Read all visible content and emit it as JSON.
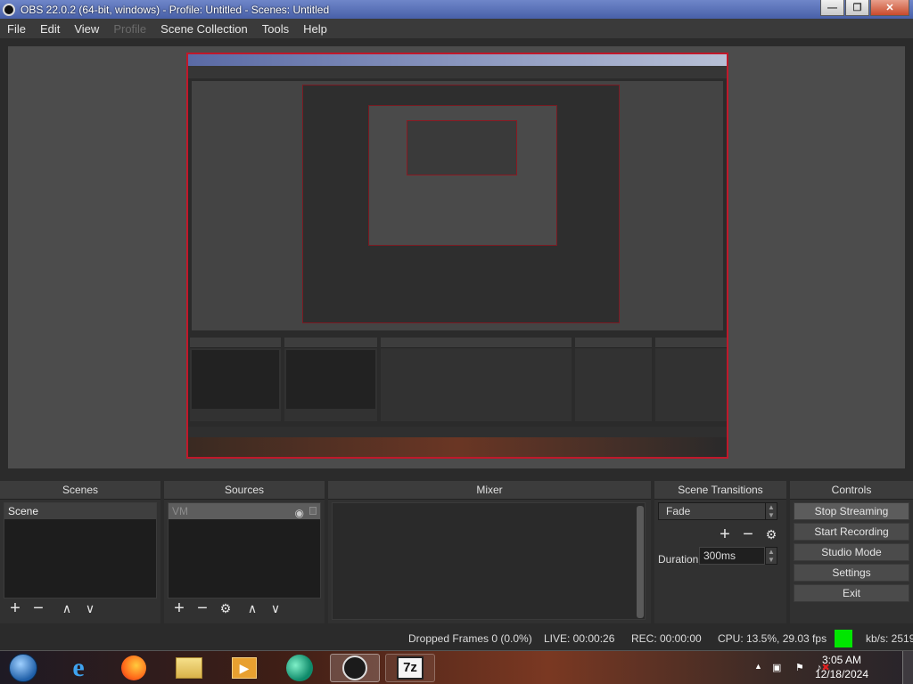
{
  "window": {
    "title": "OBS 22.0.2 (64-bit, windows) - Profile: Untitled - Scenes: Untitled",
    "buttons": [
      "minimize-button",
      "maximize-button",
      "close-button"
    ]
  },
  "menu": {
    "items": [
      {
        "label": "File",
        "enabled": true
      },
      {
        "label": "Edit",
        "enabled": true
      },
      {
        "label": "View",
        "enabled": true
      },
      {
        "label": "Profile",
        "enabled": false
      },
      {
        "label": "Scene Collection",
        "enabled": true
      },
      {
        "label": "Tools",
        "enabled": true
      },
      {
        "label": "Help",
        "enabled": true
      }
    ]
  },
  "docks": {
    "scenes": {
      "title": "Scenes",
      "items": [
        "Scene"
      ]
    },
    "sources": {
      "title": "Sources",
      "items": [
        {
          "name": "VM",
          "visible_icon": "eye-icon",
          "lock_icon": "lock-icon"
        }
      ]
    },
    "mixer": {
      "title": "Mixer"
    },
    "transitions": {
      "title": "Scene Transitions",
      "selected": "Fade",
      "duration_label": "Duration",
      "duration_value": "300ms"
    },
    "controls": {
      "title": "Controls",
      "buttons": [
        "Stop Streaming",
        "Start Recording",
        "Studio Mode",
        "Settings",
        "Exit"
      ]
    }
  },
  "status": {
    "dropped_frames": "Dropped Frames 0 (0.0%)",
    "live": "LIVE: 00:00:26",
    "rec": "REC: 00:00:00",
    "cpu": "CPU: 13.5%, 29.03 fps",
    "health_color": "#00e600",
    "bitrate": "kb/s: 2519"
  },
  "taskbar": {
    "apps": [
      "windows-start-icon",
      "internet-explorer-icon",
      "firefox-icon",
      "file-explorer-icon",
      "media-player-icon",
      "edge-icon",
      "obs-icon",
      "7zip-icon"
    ],
    "tray_arrow": "▲",
    "time": "3:05 AM",
    "date": "12/18/2024",
    "sevenzip_label": "7z"
  },
  "colors": {
    "preview_border": "#c0182a",
    "background": "#2b2b2b",
    "panel": "#313131"
  }
}
